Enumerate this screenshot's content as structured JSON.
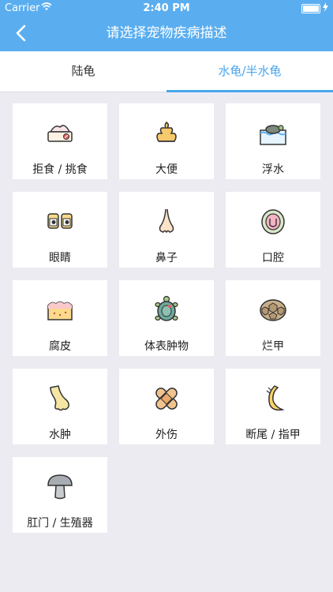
{
  "status_bar": {
    "carrier": "Carrier",
    "time": "2:40 PM"
  },
  "header": {
    "title": "请选择宠物疾病描述"
  },
  "tabs": [
    {
      "label": "陆龟",
      "selected": false
    },
    {
      "label": "水龟/半水龟",
      "selected": true
    }
  ],
  "colors": {
    "header": "#5aaef0",
    "accent": "#4aa6ee",
    "background": "#ecebf1"
  },
  "symptoms": [
    {
      "label": "拒食 / 挑食",
      "icon": "food-bowl-icon"
    },
    {
      "label": "大便",
      "icon": "poop-icon"
    },
    {
      "label": "浮水",
      "icon": "floating-turtle-icon"
    },
    {
      "label": "眼睛",
      "icon": "eyes-icon"
    },
    {
      "label": "鼻子",
      "icon": "nose-icon"
    },
    {
      "label": "口腔",
      "icon": "mouth-icon"
    },
    {
      "label": "腐皮",
      "icon": "rotten-skin-icon"
    },
    {
      "label": "体表肿物",
      "icon": "turtle-body-icon"
    },
    {
      "label": "烂甲",
      "icon": "shell-icon"
    },
    {
      "label": "水肿",
      "icon": "swollen-leg-icon"
    },
    {
      "label": "外伤",
      "icon": "bandage-icon"
    },
    {
      "label": "断尾 / 指甲",
      "icon": "tail-claw-icon"
    },
    {
      "label": "肛门 / 生殖器",
      "icon": "mushroom-icon"
    }
  ]
}
